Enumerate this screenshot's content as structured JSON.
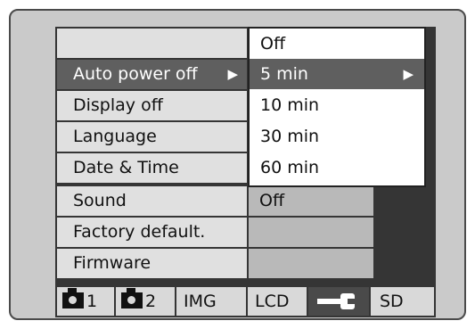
{
  "menu": {
    "items": [
      {
        "label": "Auto power off",
        "arrow": "▶",
        "value": ""
      },
      {
        "label": "Display off",
        "value": ""
      },
      {
        "label": "Language",
        "value": ""
      },
      {
        "label": "Date & Time",
        "value": ""
      },
      {
        "label": "Sound",
        "value": "Off"
      },
      {
        "label": "Factory default.",
        "value": ""
      },
      {
        "label": "Firmware",
        "value": ""
      }
    ]
  },
  "dropdown": {
    "options": [
      "Off",
      "5 min",
      "10 min",
      "30 min",
      "60 min"
    ],
    "selected_index": 1,
    "arrow": "▶"
  },
  "tabs": [
    {
      "icon": "camera-icon",
      "label": "1"
    },
    {
      "icon": "camera-icon",
      "label": "2"
    },
    {
      "label": "IMG"
    },
    {
      "label": "LCD"
    },
    {
      "icon": "wrench-icon",
      "label": ""
    },
    {
      "label": "SD"
    }
  ],
  "colors": {
    "screen_bg": "#353535",
    "menu_cell": "#e0e0e0",
    "selected": "#5f5f5f",
    "value_cell": "#b9b9b9"
  }
}
